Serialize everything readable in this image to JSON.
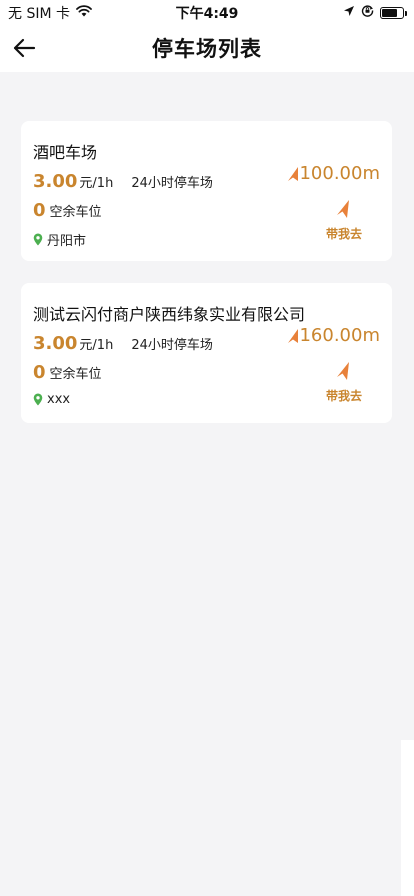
{
  "status_bar": {
    "carrier": "无 SIM 卡",
    "time": "下午4:49",
    "icons": [
      "wifi-icon",
      "location-arrow-icon",
      "orientation-lock-icon",
      "battery-icon"
    ]
  },
  "header": {
    "title": "停车场列表",
    "back_icon": "arrow-left-icon"
  },
  "colors": {
    "accent": "#c9852e",
    "nav_arrow": "#e8813a",
    "location_pin": "#4caf50",
    "background": "#f4f4f6"
  },
  "parking_lots": [
    {
      "name": "酒吧车场",
      "price": "3.00",
      "price_unit": "元/1h",
      "hours": "24小时停车场",
      "free_spaces": "0",
      "free_spaces_label": "空余车位",
      "address": "丹阳市",
      "distance": "100.00m",
      "nav_label": "带我去"
    },
    {
      "name": "测试云闪付商户陕西纬象实业有限公司",
      "price": "3.00",
      "price_unit": "元/1h",
      "hours": "24小时停车场",
      "free_spaces": "0",
      "free_spaces_label": "空余车位",
      "address": "xxx",
      "distance": "160.00m",
      "nav_label": "带我去"
    }
  ]
}
